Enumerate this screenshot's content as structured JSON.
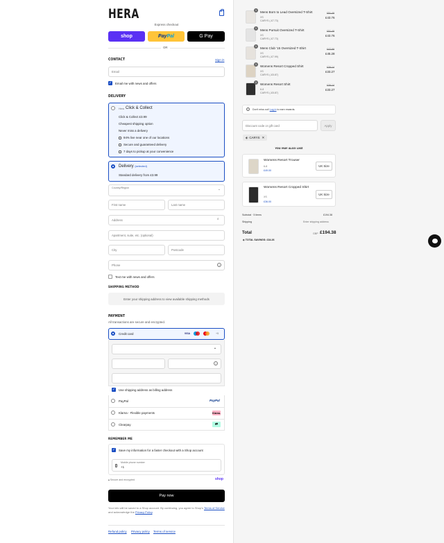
{
  "brand": "HERA",
  "express": {
    "label": "Express checkout",
    "shop": "shop",
    "paypal_a": "Pay",
    "paypal_b": "Pal",
    "gpay": "G Pay",
    "or": "OR"
  },
  "contact": {
    "heading": "Contact",
    "signin": "Sign in",
    "email_placeholder": "Email",
    "news": "Email me with news and offers"
  },
  "delivery": {
    "heading": "Delivery",
    "cc_title": "Click & Collect",
    "cc_tag": "Hera",
    "cc_price": "Click & Collect £3.99",
    "cc_lines": [
      "Cheapest shipping option",
      "Never miss a delivery"
    ],
    "cc_features": [
      "94% live near one of our locations",
      "Secure and guaranteed delivery",
      "7 days to pickup at your convenience"
    ],
    "del_title": "Delivery",
    "del_selected": "(selected)",
    "del_sub": "Standard delivery from £3.99",
    "country_label": "Country/Region",
    "first": "First name",
    "last": "Last name",
    "address": "Address",
    "apt": "Apartment, suite, etc. (optional)",
    "city": "City",
    "postcode": "Postcode",
    "phone": "Phone",
    "text_news": "Text me with news and offers"
  },
  "shipping": {
    "heading": "Shipping method",
    "msg": "Enter your shipping address to view available shipping methods"
  },
  "payment": {
    "heading": "Payment",
    "sub": "All transactions are secure and encrypted.",
    "credit": "Credit card",
    "more": "+5",
    "billing": "Use shipping address as billing address",
    "paypal": "PayPal",
    "paypal_logo": "PayPal",
    "klarna": "Klarna - Flexible payments",
    "klarna_logo": "Klarna.",
    "clearpay": "Clearpay"
  },
  "remember": {
    "heading": "Remember me",
    "save": "Save my information for a faster checkout with a Shop account",
    "mobile_label": "Mobile phone number",
    "mobile_value": "+1",
    "secure": "Secure and encrypted",
    "shop": "shop"
  },
  "pay_now": "Pay now",
  "legal": {
    "a": "Your info will be saved to a Shop account. By continuing, you agree to Shop's",
    "terms": "Terms of Service",
    "b": "and acknowledge the",
    "privacy": "Privacy Policy",
    "end": "."
  },
  "footer": [
    "Refund policy",
    "Privacy policy",
    "Terms of service"
  ],
  "cart": [
    {
      "name": "Mens Born to Lead Oversized T-Shirt",
      "size": "XS",
      "code": "CARYS (-£7.73)",
      "was": "£51.49",
      "now": "£43.76",
      "qty": "1"
    },
    {
      "name": "Mens Pursuit Oversized T-Shirt",
      "size": "XS",
      "code": "CARYS (-£7.73)",
      "was": "£51.49",
      "now": "£43.76",
      "qty": "1"
    },
    {
      "name": "Mens Club '15 Oversized T-Shirt",
      "size": "XS",
      "code": "CARYS (-£7.99)",
      "was": "£47.99",
      "now": "£45.28",
      "qty": "1"
    },
    {
      "name": "Womens Resort Cropped Shirt",
      "size": "XS",
      "code": "CARYS (-£5.87)",
      "was": "£39.14",
      "now": "£33.27",
      "qty": "1"
    },
    {
      "name": "Womens Resort Shirt",
      "size": "6-8",
      "code": "CARYS (-£5.87)",
      "was": "£39.14",
      "now": "£33.27",
      "qty": "1"
    }
  ],
  "rewards": {
    "a": "Don't miss out!",
    "login": "Log in",
    "b": "to earn rewards."
  },
  "discount": {
    "placeholder": "Discount code or gift card",
    "apply": "Apply",
    "code": "CARYS"
  },
  "upsell": {
    "heading": "You may also like",
    "items": [
      {
        "name": "Womens Resort Trouser",
        "size": "6-8",
        "price": "£49.00",
        "button": "UK Size"
      },
      {
        "name": "Womens Resort Cropped Shirt",
        "size": "XS",
        "price": "£36.00",
        "button": "UK Size"
      }
    ]
  },
  "summary": {
    "subtotal_label": "Subtotal · 5 items",
    "subtotal": "£194.38",
    "shipping_label": "Shipping",
    "shipping": "Enter shipping address",
    "total_label": "Total",
    "currency": "GBP",
    "total": "£194.38",
    "savings": "TOTAL SAVINGS: £34.26"
  },
  "colors": {
    "accent": "#1a4ec3",
    "shop": "#5a31f4",
    "paypal": "#ffc439"
  }
}
